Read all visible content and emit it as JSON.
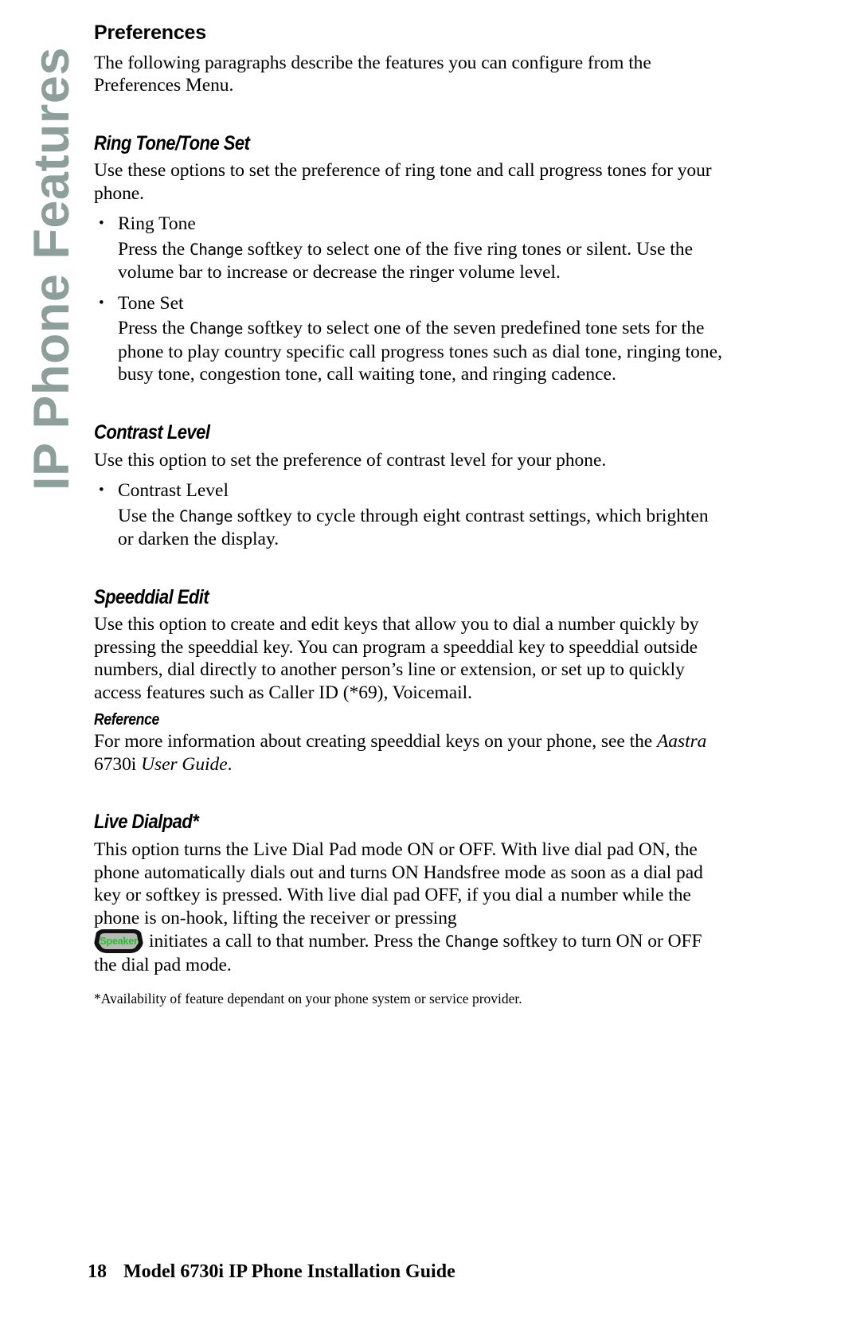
{
  "sidebar": {
    "tab_label": "IP Phone Features",
    "tab_color": "#8d9f9b"
  },
  "page": {
    "section_title": "Preferences",
    "intro": "The following paragraphs describe the features you can configure from the Preferences Menu."
  },
  "ring_tone": {
    "heading": "Ring Tone/Tone Set",
    "intro": "Use these options to set the preference of ring tone and call progress tones for your phone.",
    "bullets": [
      {
        "label": "Ring Tone",
        "body_before": "Press the ",
        "softkey": "Change",
        "body_after": " softkey to select one of the five ring tones or silent. Use the volume bar to increase or decrease the ringer volume level."
      },
      {
        "label": "Tone Set",
        "body_before": "Press the ",
        "softkey": "Change",
        "body_after": " softkey to select one of the seven predefined tone sets for the phone to play country specific call progress tones such as dial tone, ringing tone, busy tone, congestion tone, call waiting tone, and ringing cadence."
      }
    ]
  },
  "contrast_level": {
    "heading": "Contrast Level",
    "intro": "Use this option to set the preference of contrast level for your phone.",
    "bullets": [
      {
        "label": "Contrast Level",
        "body_before": "Use the ",
        "softkey": "Change",
        "body_after": " softkey to cycle through eight contrast settings, which brighten or darken the display."
      }
    ]
  },
  "speeddial_edit": {
    "heading": "Speeddial Edit",
    "intro": "Use this option to create and edit keys that allow you to dial a number quickly by pressing the speeddial key. You can program a speeddial key to speeddial outside numbers, dial directly to another person’s line or extension, or set up to quickly access features such as Caller ID (*69), Voicemail.",
    "reference_heading": "Reference",
    "reference_body": "For more information about creating speeddial keys on your phone, see the ",
    "reference_doc_italic1": "Aastra",
    "reference_doc_model": " 6730i ",
    "reference_doc_italic2": "User Guide",
    "reference_doc_end": "."
  },
  "live_dialpad": {
    "heading": "Live Dialpad*",
    "para1": "This option turns the Live Dial Pad mode ON or OFF. With live dial pad ON, the phone automatically dials out and turns ON Handsfree mode as soon as a dial pad key or softkey is pressed. With live dial pad OFF, if you dial a number while the phone is on-hook, lifting the receiver or pressing",
    "speaker_key_label": "Speaker",
    "speaker_key_text_color": "#1fc21f",
    "para2_before": "initiates a call to that number. Press the ",
    "para2_softkey": "Change",
    "para2_after": " softkey to turn ON or OFF the dial pad mode.",
    "footnote": "*Availability of feature dependant on your phone system or service provider."
  },
  "footer": {
    "page_number": "18",
    "title": "Model 6730i IP Phone Installation Guide"
  }
}
